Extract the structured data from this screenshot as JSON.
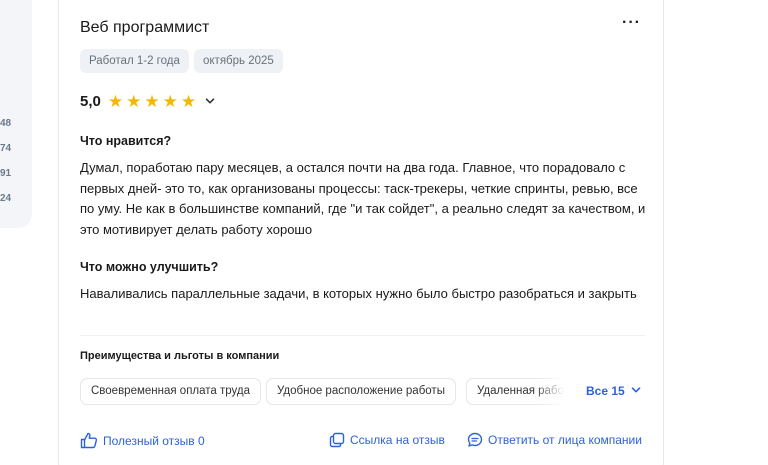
{
  "sidebar_numbers": [
    "48",
    "74",
    "91",
    "24"
  ],
  "review": {
    "title": "Веб программист",
    "more_label": "···",
    "tags": [
      "Работал 1-2 года",
      "октябрь 2025"
    ],
    "rating": 5.0,
    "rating_label": "5,0",
    "stars": 5,
    "sections": [
      {
        "title": "Что нравится?",
        "text": "Думал, поработаю пару месяцев, а остался почти на два года. Главное, что порадовало с первых дней- это то, как организованы процессы: таск-трекеры, четкие спринты, ревью, все по уму. Не как в большинстве компаний, где \"и так сойдет\", а реально следят за качеством, и это мотивирует делать работу хорошо"
      },
      {
        "title": "Что можно улучшить?",
        "text": "Наваливались параллельные задачи, в которых нужно было быстро разобраться и закрыть"
      }
    ],
    "benefits": {
      "title": "Преимущества и льготы в компании",
      "items": [
        "Своевременная оплата труда",
        "Удобное расположение работы",
        "Удаленная работа"
      ],
      "all_label": "Все 15"
    },
    "actions": {
      "helpful": "Полезный отзыв 0",
      "link": "Ссылка на отзыв",
      "reply": "Ответить от лица компании"
    }
  },
  "colors": {
    "accent": "#2c62d8",
    "star": "#f7b700",
    "chip_bg": "#eef1f5",
    "border": "#e4e7ec"
  },
  "icons": [
    "chevron-down-icon",
    "thumbs-up-icon",
    "link-icon",
    "chat-icon",
    "star-icon",
    "more-icon"
  ]
}
